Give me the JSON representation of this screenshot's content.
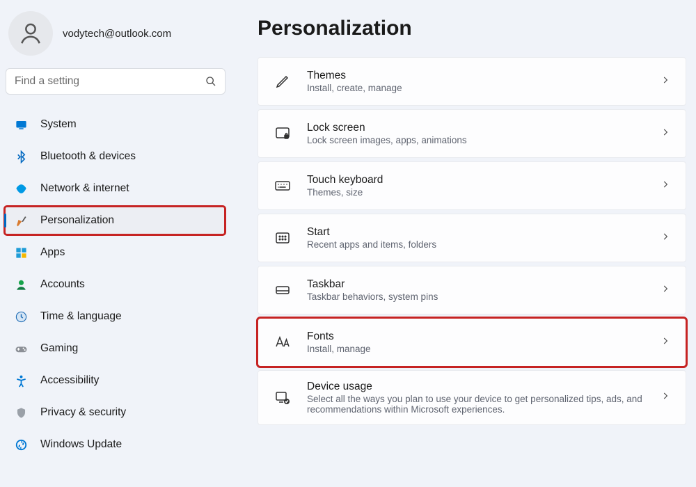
{
  "profile": {
    "email": "vodytech@outlook.com"
  },
  "search": {
    "placeholder": "Find a setting"
  },
  "page_title": "Personalization",
  "sidebar": {
    "items": [
      {
        "label": "System",
        "icon": "system"
      },
      {
        "label": "Bluetooth & devices",
        "icon": "bluetooth"
      },
      {
        "label": "Network & internet",
        "icon": "network"
      },
      {
        "label": "Personalization",
        "icon": "personalization",
        "active": true,
        "highlighted": true
      },
      {
        "label": "Apps",
        "icon": "apps"
      },
      {
        "label": "Accounts",
        "icon": "accounts"
      },
      {
        "label": "Time & language",
        "icon": "time"
      },
      {
        "label": "Gaming",
        "icon": "gaming"
      },
      {
        "label": "Accessibility",
        "icon": "accessibility"
      },
      {
        "label": "Privacy & security",
        "icon": "privacy"
      },
      {
        "label": "Windows Update",
        "icon": "update"
      }
    ]
  },
  "cards": [
    {
      "title": "Themes",
      "subtitle": "Install, create, manage",
      "icon": "pen"
    },
    {
      "title": "Lock screen",
      "subtitle": "Lock screen images, apps, animations",
      "icon": "lock-screen"
    },
    {
      "title": "Touch keyboard",
      "subtitle": "Themes, size",
      "icon": "keyboard"
    },
    {
      "title": "Start",
      "subtitle": "Recent apps and items, folders",
      "icon": "start"
    },
    {
      "title": "Taskbar",
      "subtitle": "Taskbar behaviors, system pins",
      "icon": "taskbar"
    },
    {
      "title": "Fonts",
      "subtitle": "Install, manage",
      "icon": "fonts",
      "highlighted": true
    },
    {
      "title": "Device usage",
      "subtitle": "Select all the ways you plan to use your device to get personalized tips, ads, and recommendations within Microsoft experiences.",
      "icon": "device-usage"
    }
  ]
}
